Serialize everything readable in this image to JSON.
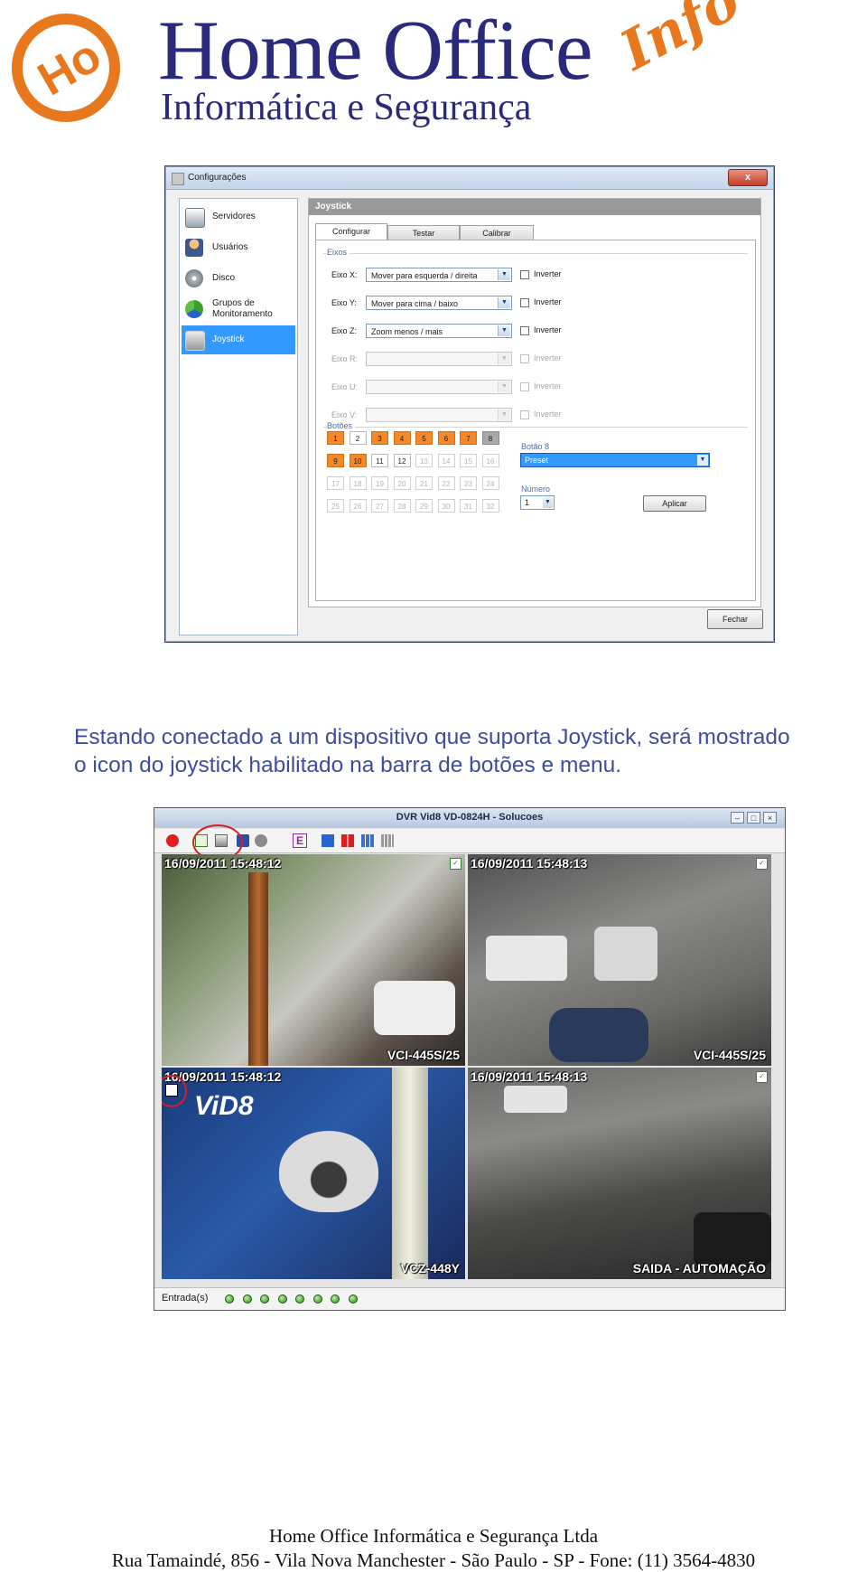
{
  "logo": {
    "title": "Home Office",
    "subtitle": "Informática e Segurança",
    "script": "Info",
    "mark": "Ho",
    "colors": {
      "navy": "#2a2a7c",
      "orange": "#e8781e"
    }
  },
  "config_window": {
    "title": "Configurações",
    "close_glyph": "x",
    "sidebar": [
      {
        "label": "Servidores",
        "icon": "server-icon"
      },
      {
        "label": "Usuários",
        "icon": "users-icon"
      },
      {
        "label": "Disco",
        "icon": "disk-icon"
      },
      {
        "label": "Grupos de\nMonitoramento",
        "icon": "groups-icon"
      },
      {
        "label": "Joystick",
        "icon": "joystick-icon",
        "active": true
      }
    ],
    "panel_title": "Joystick",
    "tabs": [
      "Configurar",
      "Testar",
      "Calibrar"
    ],
    "active_tab": "Configurar",
    "eixos_label": "Eixos",
    "axes": [
      {
        "label": "Eixo X:",
        "value": "Mover para esquerda / direita",
        "invert": "Inverter",
        "enabled": true
      },
      {
        "label": "Eixo Y:",
        "value": "Mover para cima / baixo",
        "invert": "Inverter",
        "enabled": true
      },
      {
        "label": "Eixo Z:",
        "value": "Zoom menos / mais",
        "invert": "Inverter",
        "enabled": true
      },
      {
        "label": "Eixo R:",
        "value": "",
        "invert": "Inverter",
        "enabled": false
      },
      {
        "label": "Eixo U:",
        "value": "",
        "invert": "Inverter",
        "enabled": false
      },
      {
        "label": "Eixo V:",
        "value": "",
        "invert": "Inverter",
        "enabled": false
      }
    ],
    "botoes_label": "Botões",
    "buttons": [
      {
        "n": "1",
        "state": "orange"
      },
      {
        "n": "2",
        "state": "white"
      },
      {
        "n": "3",
        "state": "orange"
      },
      {
        "n": "4",
        "state": "orange"
      },
      {
        "n": "5",
        "state": "orange"
      },
      {
        "n": "6",
        "state": "orange"
      },
      {
        "n": "7",
        "state": "orange"
      },
      {
        "n": "8",
        "state": "gray"
      },
      {
        "n": "9",
        "state": "orange"
      },
      {
        "n": "10",
        "state": "orange"
      },
      {
        "n": "11",
        "state": "white"
      },
      {
        "n": "12",
        "state": "white"
      },
      {
        "n": "13",
        "state": "off"
      },
      {
        "n": "14",
        "state": "off"
      },
      {
        "n": "15",
        "state": "off"
      },
      {
        "n": "16",
        "state": "off"
      },
      {
        "n": "17",
        "state": "off"
      },
      {
        "n": "18",
        "state": "off"
      },
      {
        "n": "19",
        "state": "off"
      },
      {
        "n": "20",
        "state": "off"
      },
      {
        "n": "21",
        "state": "off"
      },
      {
        "n": "22",
        "state": "off"
      },
      {
        "n": "23",
        "state": "off"
      },
      {
        "n": "24",
        "state": "off"
      },
      {
        "n": "25",
        "state": "off"
      },
      {
        "n": "26",
        "state": "off"
      },
      {
        "n": "27",
        "state": "off"
      },
      {
        "n": "28",
        "state": "off"
      },
      {
        "n": "29",
        "state": "off"
      },
      {
        "n": "30",
        "state": "off"
      },
      {
        "n": "31",
        "state": "off"
      },
      {
        "n": "32",
        "state": "off"
      }
    ],
    "selected_button_label": "Botão 8",
    "selected_action": "Preset",
    "numero_label": "Número",
    "numero_value": "1",
    "apply_button": "Aplicar",
    "close_button": "Fechar"
  },
  "paragraph": {
    "line1": "Estando conectado a um dispositivo que suporta Joystick, será mostrado",
    "line2": "o icon do joystick habilitado na barra de botões e menu."
  },
  "dvr_window": {
    "title": "DVR Vid8 VD-0824H - Solucoes",
    "toolbar_icons": [
      "record-icon",
      "tx-icon",
      "joystick-icon",
      "camera-icon",
      "refresh-icon",
      "event-icon",
      "layout-1-icon",
      "layout-4-icon",
      "layout-9-icon",
      "layout-16-icon"
    ],
    "event_glyph": "E",
    "cameras": [
      {
        "timestamp": "16/09/2011 15:48:12",
        "name": "VCI-445S/25"
      },
      {
        "timestamp": "16/09/2011 15:48:13",
        "name": "VCI-445S/25"
      },
      {
        "timestamp": "16/09/2011 15:48:12",
        "name": "VCZ-448Y"
      },
      {
        "timestamp": "16/09/2011 15:48:13",
        "name": "SAIDA - AUTOMAÇÃO"
      }
    ],
    "status_label": "Entrada(s)",
    "input_leds": 8
  },
  "footer": {
    "company": "Home Office Informática e Segurança Ltda",
    "address": "Rua Tamaindé, 856   -  Vila Nova Manchester  -  São Paulo  -  SP  -  Fone: (11) 3564-4830"
  }
}
